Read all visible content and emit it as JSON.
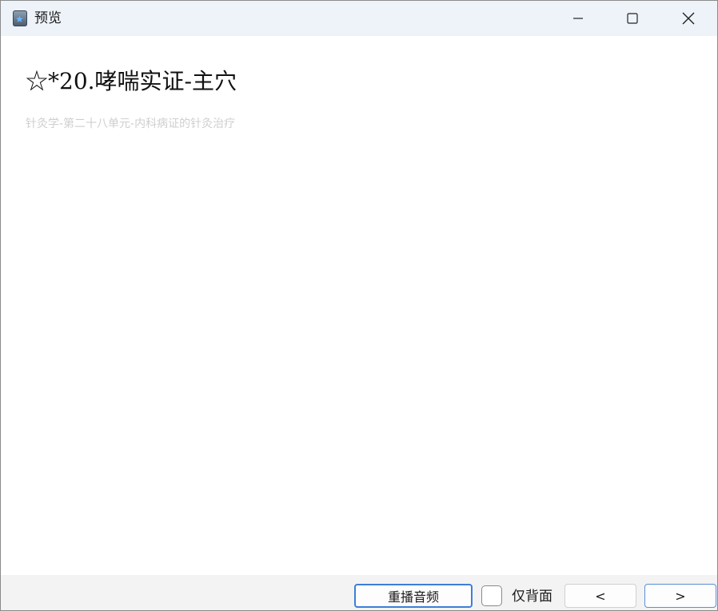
{
  "window": {
    "title": "预览",
    "app_icon": "anki-star-icon"
  },
  "controls": {
    "minimize_icon": "minimize-icon",
    "maximize_icon": "maximize-icon",
    "close_icon": "close-icon"
  },
  "card": {
    "title": "☆*20.哮喘实证-主穴",
    "subtitle": "针灸学-第二十八单元-内科病证的针灸治疗"
  },
  "bottom": {
    "replay_label": "重播音频",
    "back_only_label": "仅背面",
    "back_only_checked": false,
    "prev_label": "<",
    "next_label": ">"
  },
  "colors": {
    "titlebar_bg": "#eef3f9",
    "accent": "#3d7fd6",
    "subtitle_text": "#cfcfcf"
  }
}
